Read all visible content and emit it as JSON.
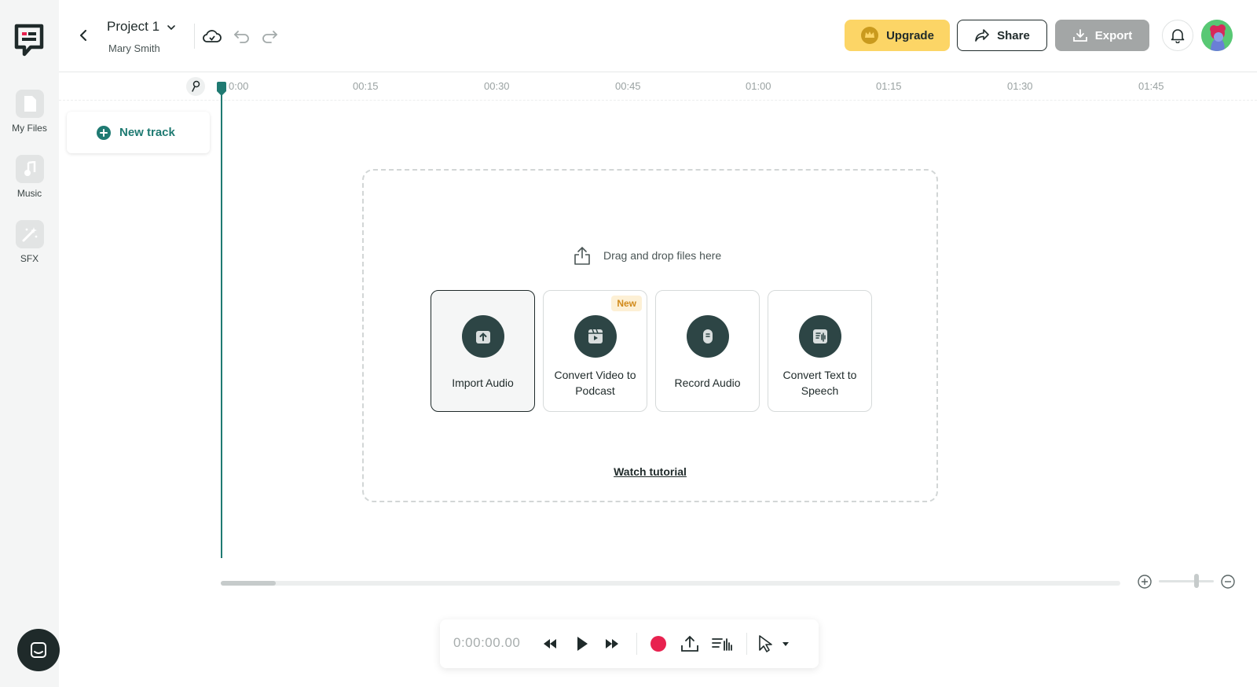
{
  "project": {
    "title": "Project 1",
    "user": "Mary Smith"
  },
  "sidebar": {
    "items": [
      {
        "label": "My Files",
        "icon": "file-icon"
      },
      {
        "label": "Music",
        "icon": "music-note-icon"
      },
      {
        "label": "SFX",
        "icon": "magic-wand-icon"
      }
    ]
  },
  "header": {
    "upgrade_label": "Upgrade",
    "share_label": "Share",
    "export_label": "Export"
  },
  "timeline": {
    "ticks": [
      "0:00",
      "00:15",
      "00:30",
      "00:45",
      "01:00",
      "01:15",
      "01:30",
      "01:45"
    ]
  },
  "tracks": {
    "new_track_label": "New track"
  },
  "dropzone": {
    "hint": "Drag and drop files here",
    "cards": [
      {
        "label": "Import Audio",
        "icon": "upload-icon"
      },
      {
        "label": "Convert Video to Podcast",
        "icon": "video-icon",
        "badge": "New"
      },
      {
        "label": "Record Audio",
        "icon": "microphone-icon"
      },
      {
        "label": "Convert Text to Speech",
        "icon": "text-to-speech-icon"
      }
    ],
    "tutorial_label": "Watch tutorial"
  },
  "transport": {
    "time": "0:00:00.00"
  },
  "colors": {
    "accent": "#1f7a72",
    "upgrade": "#fcd566",
    "record": "#e8224f",
    "export_disabled": "#a3a6a6",
    "dark": "#1f2a2a"
  }
}
